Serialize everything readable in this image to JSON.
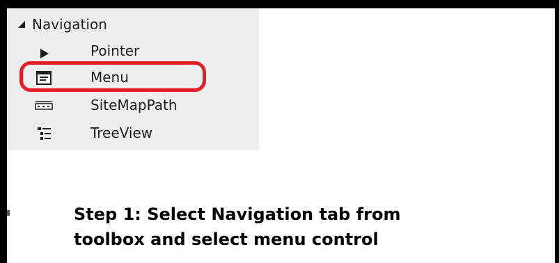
{
  "toolbox": {
    "group_label": "Navigation",
    "items": [
      {
        "label": "Pointer",
        "icon": "pointer-icon"
      },
      {
        "label": "Menu",
        "icon": "menu-icon"
      },
      {
        "label": "SiteMapPath",
        "icon": "sitemappath-icon"
      },
      {
        "label": "TreeView",
        "icon": "treeview-icon"
      }
    ],
    "highlight_color": "#e41e26"
  },
  "caption": {
    "line1": "Step 1: Select Navigation tab from",
    "line2": "toolbox and select menu control"
  }
}
